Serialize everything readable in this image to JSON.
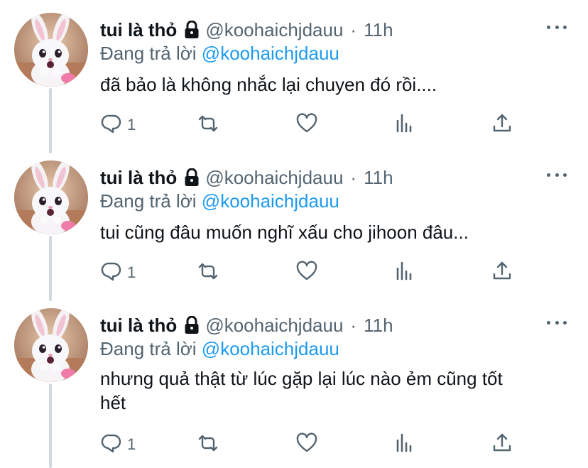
{
  "tweets": [
    {
      "name": "tui là thỏ",
      "handle": "@koohaichjdauu",
      "separator": "·",
      "time": "11h",
      "replying_prefix": "Đang trả lời",
      "replying_to": "@koohaichjdauu",
      "text": "đã bảo là không nhắc lại chuyen đó rồi....",
      "reply_count": "1"
    },
    {
      "name": "tui là thỏ",
      "handle": "@koohaichjdauu",
      "separator": "·",
      "time": "11h",
      "replying_prefix": "Đang trả lời",
      "replying_to": "@koohaichjdauu",
      "text": "tui cũng đâu muốn nghĩ xấu cho jihoon đâu...",
      "reply_count": "1"
    },
    {
      "name": "tui là thỏ",
      "handle": "@koohaichjdauu",
      "separator": "·",
      "time": "11h",
      "replying_prefix": "Đang trả lời",
      "replying_to": "@koohaichjdauu",
      "text_line1": "nhưng quả thật từ lúc gặp lại lúc nào ẻm cũng tốt",
      "text_line2": "hết",
      "reply_count": "1"
    }
  ],
  "icons": {
    "lock": "lock-icon",
    "more": "more-icon",
    "reply": "reply-icon",
    "retweet": "retweet-icon",
    "like": "heart-icon",
    "views": "views-icon",
    "share": "share-icon"
  },
  "colors": {
    "text": "#0f1419",
    "muted": "#536471",
    "link": "#1d9bf0",
    "thread_line": "#cfd9de"
  }
}
